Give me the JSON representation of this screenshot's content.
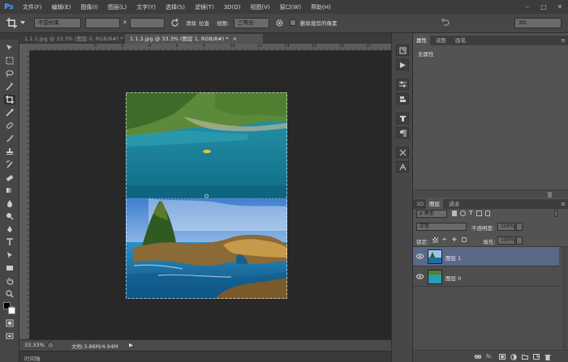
{
  "app": {
    "logo": "Ps"
  },
  "menu": [
    "文件(F)",
    "编辑(E)",
    "图像(I)",
    "图层(L)",
    "文字(Y)",
    "选择(S)",
    "滤镜(T)",
    "3D(D)",
    "视图(V)",
    "窗口(W)",
    "帮助(H)"
  ],
  "window_controls": [
    "minimize-icon",
    "maximize-icon",
    "close-icon"
  ],
  "options": {
    "ratio_select": "不受约束",
    "ratio_width": "",
    "ratio_x": "x",
    "ratio_height": "",
    "clear_label": "清除",
    "straighten_label": "拉直",
    "view_label": "视图:",
    "view_select": "三等分",
    "delete_cropped_label": "删除裁剪的像素",
    "workspace_select": "3D"
  },
  "tabs": [
    {
      "label": "1.1.1.jpg @ 33.3% (图层 0, RGB/8#) *",
      "close": "×"
    },
    {
      "label": "1.1.3.jpg @ 33.3% (图层 1, RGB/8#) *",
      "close": "×"
    }
  ],
  "ruler_ticks": [
    "0",
    "2",
    "4",
    "6",
    "8",
    "10",
    "12",
    "14",
    "16",
    "18",
    "20",
    "22",
    "24",
    "26"
  ],
  "status": {
    "zoom": "33.33%",
    "doc": "文档:3.86M/4.94M",
    "arrow": "▶"
  },
  "timeline": {
    "label": "时间轴"
  },
  "properties": {
    "tabs": [
      "属性",
      "调整",
      "画笔"
    ],
    "content": "无属性"
  },
  "layers": {
    "tabs": [
      "3D",
      "图层",
      "通道"
    ],
    "filter_select": "ρ 类型",
    "blend_select": "正常",
    "opacity_label": "不透明度:",
    "opacity_value": "100%",
    "lock_label": "锁定:",
    "fill_label": "填充:",
    "fill_value": "100%",
    "items": [
      {
        "name": "图层 1",
        "selected": true
      },
      {
        "name": "图层 0",
        "selected": false
      }
    ]
  },
  "colors": {
    "accent": "#4da0ff",
    "selected_layer": "#5a6987",
    "lake": "#1b8ea0",
    "sea": "#1e6fa8"
  }
}
